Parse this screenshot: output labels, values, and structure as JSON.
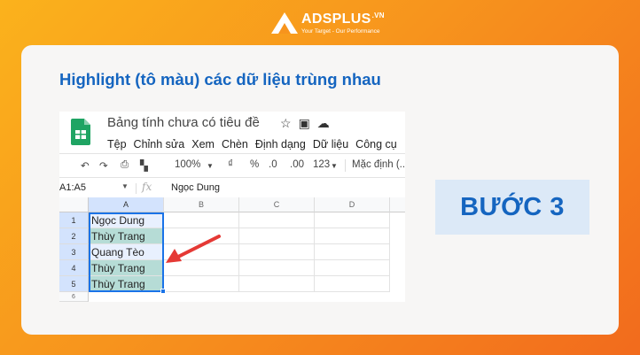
{
  "logo": {
    "text": "ADSPLUS",
    "suffix": ".VN",
    "tagline": "Your Target - Our Performance"
  },
  "heading": "Highlight (tô màu) các dữ liệu trùng nhau",
  "sheet": {
    "doc_title": "Bảng tính chưa có tiêu đề",
    "title_icons": [
      "star-icon",
      "folder-move-icon",
      "cloud-icon"
    ],
    "menu": [
      "Tệp",
      "Chỉnh sửa",
      "Xem",
      "Chèn",
      "Định dạng",
      "Dữ liệu",
      "Công cụ"
    ],
    "toolbar": {
      "zoom": "100%",
      "currency": "₫",
      "percent": "%",
      "dec_decrease": ".0",
      "dec_increase": ".00",
      "number_format": "123",
      "font": "Mặc định (..."
    },
    "name_box": "A1:A5",
    "fx_label": "fx",
    "formula_value": "Ngọc Dung",
    "columns": [
      "A",
      "B",
      "C",
      "D"
    ],
    "rows": [
      "1",
      "2",
      "3",
      "4",
      "5",
      "6"
    ],
    "cells": [
      "Ngọc Dung",
      "Thùy Trang",
      "Quang Tèo",
      "Thùy Trang",
      "Thùy Trang"
    ],
    "highlight_color": "#b6dcd6",
    "selection_color": "#1a73e8"
  },
  "step_label": "BƯỚC 3",
  "colors": {
    "accent": "#1565c0",
    "arrow": "#e53935",
    "background": "#f7941d"
  }
}
